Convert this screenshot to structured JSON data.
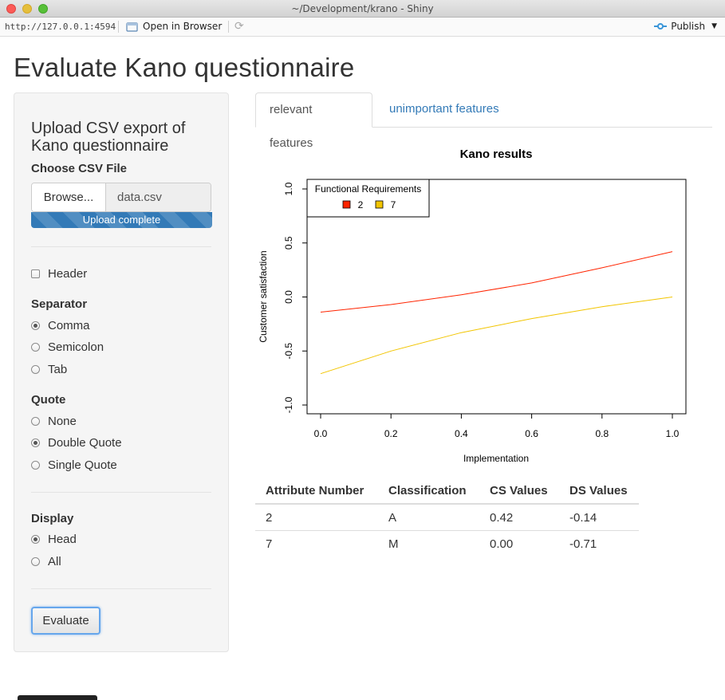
{
  "window": {
    "title": "~/Development/krano - Shiny"
  },
  "toolbar": {
    "url": "http://127.0.0.1:4594",
    "open_label": "Open in Browser",
    "publish_label": "Publish"
  },
  "app": {
    "title": "Evaluate Kano questionnaire"
  },
  "sidebar": {
    "title": "Upload CSV export of Kano questionnaire",
    "file_label": "Choose CSV File",
    "browse_label": "Browse...",
    "file_name": "data.csv",
    "upload_status": "Upload complete",
    "header_label": "Header",
    "header_checked": false,
    "separator": {
      "label": "Separator",
      "options": [
        "Comma",
        "Semicolon",
        "Tab"
      ],
      "selected": "Comma"
    },
    "quote": {
      "label": "Quote",
      "options": [
        "None",
        "Double Quote",
        "Single Quote"
      ],
      "selected": "Double Quote"
    },
    "display": {
      "label": "Display",
      "options": [
        "Head",
        "All"
      ],
      "selected": "Head"
    },
    "evaluate_label": "Evaluate"
  },
  "tabs": [
    {
      "label": "relevant features",
      "active": true
    },
    {
      "label": "unimportant features",
      "active": false
    }
  ],
  "chart_data": {
    "type": "line",
    "title": "Kano results",
    "xlabel": "Implementation",
    "ylabel": "Customer satisfaction",
    "xlim": [
      0,
      1
    ],
    "ylim": [
      -1,
      1
    ],
    "xticks": [
      "0.0",
      "0.2",
      "0.4",
      "0.6",
      "0.8",
      "1.0"
    ],
    "yticks": [
      "-1.0",
      "-0.5",
      "0.0",
      "0.5",
      "1.0"
    ],
    "legend": {
      "title": "Functional Requirements",
      "position": "top-left"
    },
    "series": [
      {
        "name": "2",
        "color": "#ff2400",
        "x": [
          0,
          0.2,
          0.4,
          0.6,
          0.8,
          1.0
        ],
        "y": [
          -0.14,
          -0.07,
          0.02,
          0.13,
          0.27,
          0.42
        ]
      },
      {
        "name": "7",
        "color": "#f2c500",
        "x": [
          0,
          0.2,
          0.4,
          0.6,
          0.8,
          1.0
        ],
        "y": [
          -0.71,
          -0.5,
          -0.33,
          -0.2,
          -0.09,
          0.0
        ]
      }
    ]
  },
  "table": {
    "headers": [
      "Attribute Number",
      "Classification",
      "CS Values",
      "DS Values"
    ],
    "rows": [
      [
        "2",
        "A",
        "0.42",
        "-0.14"
      ],
      [
        "7",
        "M",
        "0.00",
        "-0.71"
      ]
    ]
  }
}
